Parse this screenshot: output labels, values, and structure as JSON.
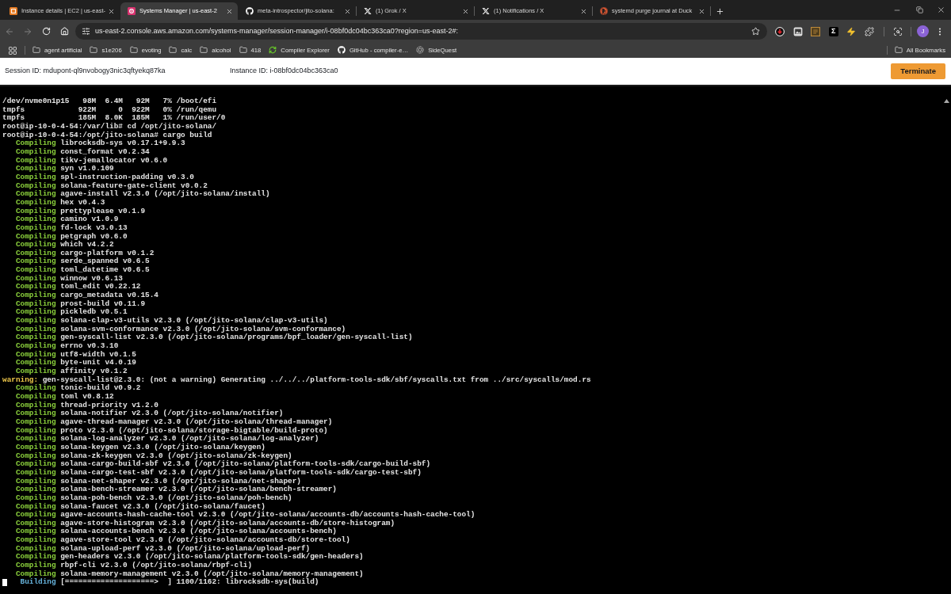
{
  "browser": {
    "tabs": [
      {
        "kind": "console",
        "title": "Instance details | EC2 | us-east-",
        "selected": false
      },
      {
        "kind": "manager",
        "title": "Systems Manager | us-east-2",
        "selected": true
      },
      {
        "kind": "github",
        "title": "meta-introspector/jito-solana:",
        "selected": false
      },
      {
        "kind": "x",
        "title": "(1) Grok / X",
        "selected": false
      },
      {
        "kind": "x",
        "title": "(1) Notifications / X",
        "selected": false
      },
      {
        "kind": "search",
        "title": "systemd purge journal at Duck",
        "selected": false
      }
    ],
    "navigation": {
      "back_disabled": true,
      "forward_disabled": true
    },
    "url": "us-east-2.console.aws.amazon.com/systems-manager/session-manager/i-08bf0dc04bc363ca0?region=us-east-2#:",
    "extensions": [
      {
        "kind": "download"
      },
      {
        "kind": "capture"
      },
      {
        "kind": "tile"
      },
      {
        "kind": "sigma",
        "glyph": "Σ"
      },
      {
        "kind": "bolt"
      },
      {
        "kind": "puzzle"
      }
    ],
    "profile_initial": "J",
    "bookmarks": [
      {
        "kind": "folder",
        "label": "agent artificial"
      },
      {
        "kind": "folder",
        "label": "s1e206"
      },
      {
        "kind": "folder",
        "label": "evoting"
      },
      {
        "kind": "folder",
        "label": "calc"
      },
      {
        "kind": "folder",
        "label": "alcohol"
      },
      {
        "kind": "folder",
        "label": "418"
      },
      {
        "kind": "compiler",
        "label": "Compiler Explorer"
      },
      {
        "kind": "github",
        "label": "GitHub - compiler-e…"
      },
      {
        "kind": "sidequest",
        "label": "SideQuest"
      }
    ],
    "all_bookmarks": "All Bookmarks"
  },
  "session": {
    "session_id": "Session ID: mdupont-ql9nvobogy3nic3qftyekq87ka",
    "instance_id": "Instance ID: i-08bf0dc04bc363ca0",
    "terminate_button": "Terminate"
  },
  "terminal": {
    "lines": [
      {
        "kind": "plain",
        "text": "/dev/nvme0n1p15   98M  6.4M   92M   7% /boot/efi"
      },
      {
        "kind": "plain",
        "text": "tmpfs            922M     0  922M   0% /run/qemu"
      },
      {
        "kind": "plain",
        "text": "tmpfs            185M  8.0K  185M   1% /run/user/0"
      },
      {
        "kind": "plain",
        "text": "root@ip-10-0-4-54:/var/lib# cd /opt/jito-solana/"
      },
      {
        "kind": "plain",
        "text": "root@ip-10-0-4-54:/opt/jito-solana# cargo build"
      },
      {
        "kind": "compiling",
        "status": "Compiling",
        "text": "librocksdb-sys v0.17.1+9.9.3"
      },
      {
        "kind": "compiling",
        "status": "Compiling",
        "text": "const_format v0.2.34"
      },
      {
        "kind": "compiling",
        "status": "Compiling",
        "text": "tikv-jemallocator v0.6.0"
      },
      {
        "kind": "compiling",
        "status": "Compiling",
        "text": "syn v1.0.109"
      },
      {
        "kind": "compiling",
        "status": "Compiling",
        "text": "spl-instruction-padding v0.3.0"
      },
      {
        "kind": "compiling",
        "status": "Compiling",
        "text": "solana-feature-gate-client v0.0.2"
      },
      {
        "kind": "compiling",
        "status": "Compiling",
        "text": "agave-install v2.3.0 (/opt/jito-solana/install)"
      },
      {
        "kind": "compiling",
        "status": "Compiling",
        "text": "hex v0.4.3"
      },
      {
        "kind": "compiling",
        "status": "Compiling",
        "text": "prettyplease v0.1.9"
      },
      {
        "kind": "compiling",
        "status": "Compiling",
        "text": "camino v1.0.9"
      },
      {
        "kind": "compiling",
        "status": "Compiling",
        "text": "fd-lock v3.0.13"
      },
      {
        "kind": "compiling",
        "status": "Compiling",
        "text": "petgraph v0.6.0"
      },
      {
        "kind": "compiling",
        "status": "Compiling",
        "text": "which v4.2.2"
      },
      {
        "kind": "compiling",
        "status": "Compiling",
        "text": "cargo-platform v0.1.2"
      },
      {
        "kind": "compiling",
        "status": "Compiling",
        "text": "serde_spanned v0.6.5"
      },
      {
        "kind": "compiling",
        "status": "Compiling",
        "text": "toml_datetime v0.6.5"
      },
      {
        "kind": "compiling",
        "status": "Compiling",
        "text": "winnow v0.6.13"
      },
      {
        "kind": "compiling",
        "status": "Compiling",
        "text": "toml_edit v0.22.12"
      },
      {
        "kind": "compiling",
        "status": "Compiling",
        "text": "cargo_metadata v0.15.4"
      },
      {
        "kind": "compiling",
        "status": "Compiling",
        "text": "prost-build v0.11.9"
      },
      {
        "kind": "compiling",
        "status": "Compiling",
        "text": "pickledb v0.5.1"
      },
      {
        "kind": "compiling",
        "status": "Compiling",
        "text": "solana-clap-v3-utils v2.3.0 (/opt/jito-solana/clap-v3-utils)"
      },
      {
        "kind": "compiling",
        "status": "Compiling",
        "text": "solana-svm-conformance v2.3.0 (/opt/jito-solana/svm-conformance)"
      },
      {
        "kind": "compiling",
        "status": "Compiling",
        "text": "gen-syscall-list v2.3.0 (/opt/jito-solana/programs/bpf_loader/gen-syscall-list)"
      },
      {
        "kind": "compiling",
        "status": "Compiling",
        "text": "errno v0.3.10"
      },
      {
        "kind": "compiling",
        "status": "Compiling",
        "text": "utf8-width v0.1.5"
      },
      {
        "kind": "compiling",
        "status": "Compiling",
        "text": "byte-unit v4.0.19"
      },
      {
        "kind": "compiling",
        "status": "Compiling",
        "text": "affinity v0.1.2"
      },
      {
        "kind": "warning",
        "status": "warning:",
        "text": "gen-syscall-list@2.3.0: (not a warning) Generating ../../../platform-tools-sdk/sbf/syscalls.txt from ../src/syscalls/mod.rs"
      },
      {
        "kind": "compiling",
        "status": "Compiling",
        "text": "tonic-build v0.9.2"
      },
      {
        "kind": "compiling",
        "status": "Compiling",
        "text": "toml v0.8.12"
      },
      {
        "kind": "compiling",
        "status": "Compiling",
        "text": "thread-priority v1.2.0"
      },
      {
        "kind": "compiling",
        "status": "Compiling",
        "text": "solana-notifier v2.3.0 (/opt/jito-solana/notifier)"
      },
      {
        "kind": "compiling",
        "status": "Compiling",
        "text": "agave-thread-manager v2.3.0 (/opt/jito-solana/thread-manager)"
      },
      {
        "kind": "compiling",
        "status": "Compiling",
        "text": "proto v2.3.0 (/opt/jito-solana/storage-bigtable/build-proto)"
      },
      {
        "kind": "compiling",
        "status": "Compiling",
        "text": "solana-log-analyzer v2.3.0 (/opt/jito-solana/log-analyzer)"
      },
      {
        "kind": "compiling",
        "status": "Compiling",
        "text": "solana-keygen v2.3.0 (/opt/jito-solana/keygen)"
      },
      {
        "kind": "compiling",
        "status": "Compiling",
        "text": "solana-zk-keygen v2.3.0 (/opt/jito-solana/zk-keygen)"
      },
      {
        "kind": "compiling",
        "status": "Compiling",
        "text": "solana-cargo-build-sbf v2.3.0 (/opt/jito-solana/platform-tools-sdk/cargo-build-sbf)"
      },
      {
        "kind": "compiling",
        "status": "Compiling",
        "text": "solana-cargo-test-sbf v2.3.0 (/opt/jito-solana/platform-tools-sdk/cargo-test-sbf)"
      },
      {
        "kind": "compiling",
        "status": "Compiling",
        "text": "solana-net-shaper v2.3.0 (/opt/jito-solana/net-shaper)"
      },
      {
        "kind": "compiling",
        "status": "Compiling",
        "text": "solana-bench-streamer v2.3.0 (/opt/jito-solana/bench-streamer)"
      },
      {
        "kind": "compiling",
        "status": "Compiling",
        "text": "solana-poh-bench v2.3.0 (/opt/jito-solana/poh-bench)"
      },
      {
        "kind": "compiling",
        "status": "Compiling",
        "text": "solana-faucet v2.3.0 (/opt/jito-solana/faucet)"
      },
      {
        "kind": "compiling",
        "status": "Compiling",
        "text": "agave-accounts-hash-cache-tool v2.3.0 (/opt/jito-solana/accounts-db/accounts-hash-cache-tool)"
      },
      {
        "kind": "compiling",
        "status": "Compiling",
        "text": "agave-store-histogram v2.3.0 (/opt/jito-solana/accounts-db/store-histogram)"
      },
      {
        "kind": "compiling",
        "status": "Compiling",
        "text": "solana-accounts-bench v2.3.0 (/opt/jito-solana/accounts-bench)"
      },
      {
        "kind": "compiling",
        "status": "Compiling",
        "text": "agave-store-tool v2.3.0 (/opt/jito-solana/accounts-db/store-tool)"
      },
      {
        "kind": "compiling",
        "status": "Compiling",
        "text": "solana-upload-perf v2.3.0 (/opt/jito-solana/upload-perf)"
      },
      {
        "kind": "compiling",
        "status": "Compiling",
        "text": "gen-headers v2.3.0 (/opt/jito-solana/platform-tools-sdk/gen-headers)"
      },
      {
        "kind": "compiling",
        "status": "Compiling",
        "text": "rbpf-cli v2.3.0 (/opt/jito-solana/rbpf-cli)"
      },
      {
        "kind": "compiling",
        "status": "Compiling",
        "text": "solana-memory-management v2.3.0 (/opt/jito-solana/memory-management)"
      },
      {
        "kind": "progress",
        "status": "Building",
        "text": "[====================>  ] 1100/1162: librocksdb-sys(build)",
        "cursor": true
      }
    ]
  }
}
